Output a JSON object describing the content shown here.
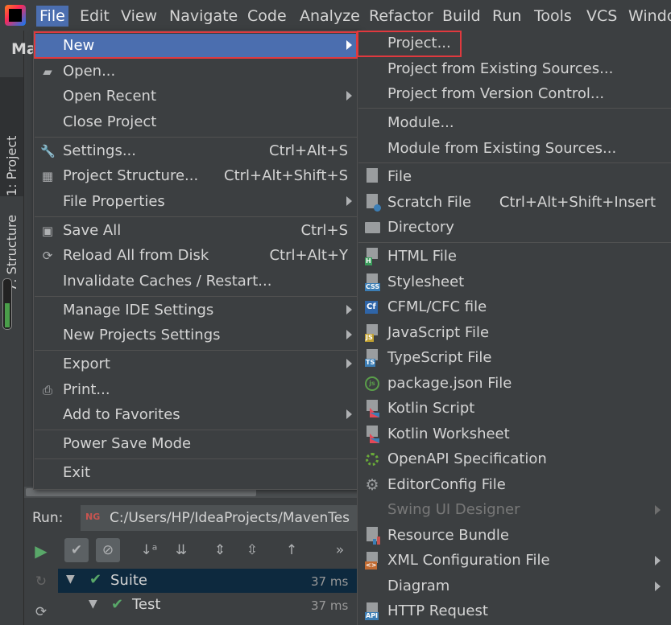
{
  "menubar": {
    "items": [
      "File",
      "Edit",
      "View",
      "Navigate",
      "Code",
      "Analyze",
      "Refactor",
      "Build",
      "Run",
      "Tools",
      "VCS",
      "Windo"
    ]
  },
  "toolwindows": {
    "project_tab": "1: Project",
    "structure_tab": "7: Structure"
  },
  "background": {
    "header_fragment": "Ma"
  },
  "file_menu": {
    "items": [
      {
        "label": "New",
        "icon": "",
        "shortcut": "",
        "submenu": true
      },
      {
        "label": "Open...",
        "icon": "folder-icon",
        "shortcut": "",
        "submenu": false
      },
      {
        "label": "Open Recent",
        "icon": "",
        "shortcut": "",
        "submenu": true
      },
      {
        "label": "Close Project",
        "icon": "",
        "shortcut": "",
        "submenu": false
      },
      {
        "label": "Settings...",
        "icon": "wrench-icon",
        "shortcut": "Ctrl+Alt+S",
        "submenu": false
      },
      {
        "label": "Project Structure...",
        "icon": "project-structure-icon",
        "shortcut": "Ctrl+Alt+Shift+S",
        "submenu": false
      },
      {
        "label": "File Properties",
        "icon": "",
        "shortcut": "",
        "submenu": true
      },
      {
        "label": "Save All",
        "icon": "save-icon",
        "shortcut": "Ctrl+S",
        "submenu": false
      },
      {
        "label": "Reload All from Disk",
        "icon": "reload-icon",
        "shortcut": "Ctrl+Alt+Y",
        "submenu": false
      },
      {
        "label": "Invalidate Caches / Restart...",
        "icon": "",
        "shortcut": "",
        "submenu": false
      },
      {
        "label": "Manage IDE Settings",
        "icon": "",
        "shortcut": "",
        "submenu": true
      },
      {
        "label": "New Projects Settings",
        "icon": "",
        "shortcut": "",
        "submenu": true
      },
      {
        "label": "Export",
        "icon": "",
        "shortcut": "",
        "submenu": true
      },
      {
        "label": "Print...",
        "icon": "print-icon",
        "shortcut": "",
        "submenu": false
      },
      {
        "label": "Add to Favorites",
        "icon": "",
        "shortcut": "",
        "submenu": true
      },
      {
        "label": "Power Save Mode",
        "icon": "",
        "shortcut": "",
        "submenu": false
      },
      {
        "label": "Exit",
        "icon": "",
        "shortcut": "",
        "submenu": false
      }
    ]
  },
  "new_menu": {
    "items": [
      {
        "label": "Project...",
        "icon": "",
        "shortcut": ""
      },
      {
        "label": "Project from Existing Sources...",
        "icon": "",
        "shortcut": ""
      },
      {
        "label": "Project from Version Control...",
        "icon": "",
        "shortcut": ""
      },
      {
        "label": "Module...",
        "icon": "",
        "shortcut": ""
      },
      {
        "label": "Module from Existing Sources...",
        "icon": "",
        "shortcut": ""
      },
      {
        "label": "File",
        "icon": "file-icon",
        "shortcut": ""
      },
      {
        "label": "Scratch File",
        "icon": "scratch-file-icon",
        "shortcut": "Ctrl+Alt+Shift+Insert"
      },
      {
        "label": "Directory",
        "icon": "directory-icon",
        "shortcut": ""
      },
      {
        "label": "HTML File",
        "icon": "html-file-icon",
        "tag": "H",
        "tag_color": "#3a9b5b",
        "shortcut": ""
      },
      {
        "label": "Stylesheet",
        "icon": "css-file-icon",
        "tag": "CSS",
        "tag_color": "#3c7eb5",
        "shortcut": ""
      },
      {
        "label": "CFML/CFC file",
        "icon": "cfml-file-icon",
        "tag": "Cf",
        "tag_color": "#2f65a8",
        "shortcut": ""
      },
      {
        "label": "JavaScript File",
        "icon": "javascript-file-icon",
        "tag": "JS",
        "tag_color": "#c0a030",
        "shortcut": ""
      },
      {
        "label": "TypeScript File",
        "icon": "typescript-file-icon",
        "tag": "TS",
        "tag_color": "#3c7eb5",
        "shortcut": ""
      },
      {
        "label": "package.json File",
        "icon": "nodejs-icon",
        "shortcut": ""
      },
      {
        "label": "Kotlin Script",
        "icon": "kotlin-script-icon",
        "shortcut": ""
      },
      {
        "label": "Kotlin Worksheet",
        "icon": "kotlin-worksheet-icon",
        "shortcut": ""
      },
      {
        "label": "OpenAPI Specification",
        "icon": "openapi-icon",
        "shortcut": ""
      },
      {
        "label": "EditorConfig File",
        "icon": "gear-icon",
        "shortcut": ""
      },
      {
        "label": "Swing UI Designer",
        "icon": "",
        "shortcut": "",
        "disabled": true
      },
      {
        "label": "Resource Bundle",
        "icon": "resource-bundle-icon",
        "shortcut": ""
      },
      {
        "label": "XML Configuration File",
        "icon": "xml-file-icon",
        "shortcut": ""
      },
      {
        "label": "Diagram",
        "icon": "",
        "shortcut": ""
      },
      {
        "label": "HTTP Request",
        "icon": "http-request-icon",
        "tag": "API",
        "tag_color": "#3c7eb5",
        "shortcut": ""
      }
    ]
  },
  "run_panel": {
    "label": "Run:",
    "tab_text": "C:/Users/HP/IdeaProjects/MavenTes",
    "tab_icon_text": "NG",
    "tree": [
      {
        "label": "Suite",
        "time": "37 ms"
      },
      {
        "label": "Test",
        "time": "37 ms"
      }
    ]
  },
  "colors": {
    "menu_bg": "#3c3f41",
    "selection": "#4b6eaf",
    "highlight_box": "#e0393e",
    "pass_green": "#59a869"
  }
}
